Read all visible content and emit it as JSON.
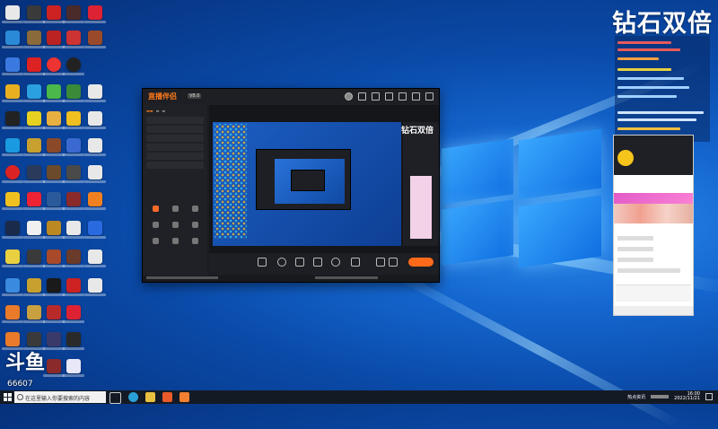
{
  "overlay": {
    "title": "钻石双倍",
    "mini_title": "钻石双倍"
  },
  "watermark": {
    "number": "66607"
  },
  "taskbar": {
    "search_placeholder": "在这里输入你要搜索的内容",
    "tray_label": "热点资讯",
    "time": "16:00",
    "date": "2022/11/21"
  },
  "app": {
    "logo": "直播伴侣",
    "version": "V8.0"
  },
  "colors": {
    "accent": "#ff6a1a",
    "desktop": "#0a4aa8"
  }
}
